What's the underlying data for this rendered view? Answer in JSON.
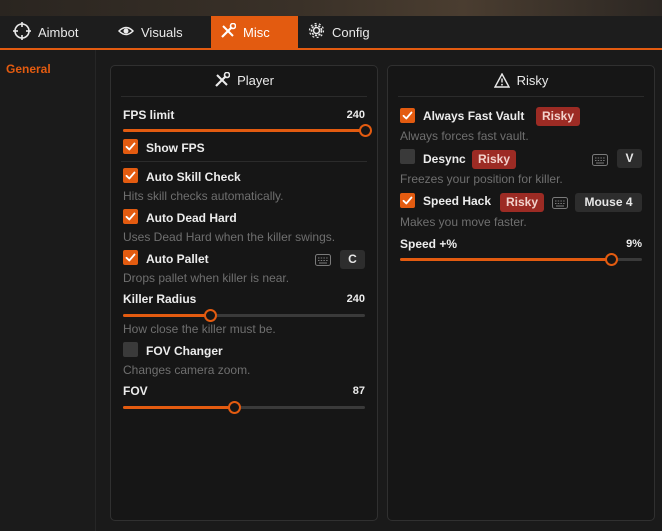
{
  "tabs": [
    {
      "label": "Aimbot",
      "icon": "crosshair-icon"
    },
    {
      "label": "Visuals",
      "icon": "eye-icon"
    },
    {
      "label": "Misc",
      "icon": "tools-icon",
      "active": true
    },
    {
      "label": "Config",
      "icon": "gear-icon"
    }
  ],
  "sidebar": {
    "items": [
      {
        "label": "General",
        "active": true
      }
    ]
  },
  "player": {
    "title": "Player",
    "fps_limit": {
      "label": "FPS limit",
      "value": "240",
      "fraction": 1.0
    },
    "show_fps": {
      "label": "Show FPS",
      "checked": true
    },
    "auto_skill_check": {
      "label": "Auto Skill Check",
      "checked": true,
      "desc": "Hits skill checks automatically."
    },
    "auto_dead_hard": {
      "label": "Auto Dead Hard",
      "checked": true,
      "desc": "Uses Dead Hard when the killer swings."
    },
    "auto_pallet": {
      "label": "Auto Pallet",
      "checked": true,
      "desc": "Drops pallet when killer is near.",
      "key": "C"
    },
    "killer_radius": {
      "label": "Killer Radius",
      "value": "240",
      "fraction": 0.36,
      "desc": "How close the killer must be."
    },
    "fov_changer": {
      "label": "FOV Changer",
      "checked": false,
      "desc": "Changes camera zoom."
    },
    "fov": {
      "label": "FOV",
      "value": "87",
      "fraction": 0.46
    }
  },
  "risky": {
    "title": "Risky",
    "always_fast_vault": {
      "label": "Always Fast Vault",
      "checked": true,
      "badge": "Risky",
      "desc": "Always forces fast vault."
    },
    "desync": {
      "label": "Desync",
      "checked": false,
      "badge": "Risky",
      "desc": "Freezes your position for killer.",
      "key": "V"
    },
    "speed_hack": {
      "label": "Speed Hack",
      "checked": true,
      "badge": "Risky",
      "desc": "Makes you move faster.",
      "key": "Mouse 4"
    },
    "speed": {
      "label": "Speed +%",
      "value": "9%",
      "fraction": 0.87
    }
  },
  "colors": {
    "accent": "#e35b10",
    "badge": "#9c2b24"
  }
}
